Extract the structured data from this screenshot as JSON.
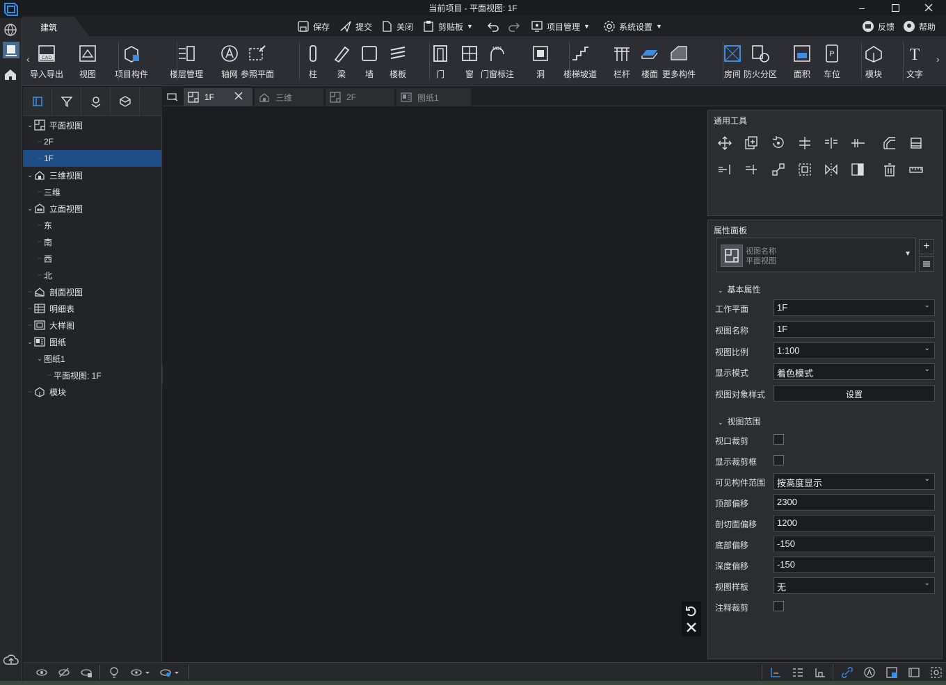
{
  "window": {
    "title": "当前项目 - 平面视图: 1F"
  },
  "ribbon_tab": "建筑",
  "quick_access": [
    {
      "label": "保存",
      "icon": "save-icon"
    },
    {
      "label": "提交",
      "icon": "submit-icon"
    },
    {
      "label": "关闭",
      "icon": "close-file-icon"
    },
    {
      "label": "剪贴板",
      "icon": "clipboard-icon"
    },
    {
      "label": "项目管理",
      "icon": "project-manage-icon"
    },
    {
      "label": "系统设置",
      "icon": "settings-icon"
    }
  ],
  "top_right": {
    "feedback": "反馈",
    "help": "帮助"
  },
  "ribbon": [
    {
      "label": "导入导出",
      "icon": "cad-import-export-icon"
    },
    {
      "label": "视图",
      "icon": "view-icon"
    },
    {
      "label": "项目构件",
      "icon": "project-component-icon"
    },
    {
      "label": "楼层管理",
      "icon": "floor-manage-icon"
    },
    {
      "label": "轴网",
      "icon": "axis-grid-icon"
    },
    {
      "label": "参照平面",
      "icon": "reference-plane-icon"
    },
    {
      "label": "柱",
      "icon": "column-icon"
    },
    {
      "label": "梁",
      "icon": "beam-icon"
    },
    {
      "label": "墙",
      "icon": "wall-icon"
    },
    {
      "label": "楼板",
      "icon": "slab-icon"
    },
    {
      "label": "门",
      "icon": "door-icon"
    },
    {
      "label": "窗",
      "icon": "window-icon"
    },
    {
      "label": "门窗标注",
      "icon": "door-window-tag-icon"
    },
    {
      "label": "洞",
      "icon": "opening-icon"
    },
    {
      "label": "楼梯坡道",
      "icon": "stair-ramp-icon"
    },
    {
      "label": "栏杆",
      "icon": "railing-icon"
    },
    {
      "label": "楼面",
      "icon": "floor-icon"
    },
    {
      "label": "更多构件",
      "icon": "more-components-icon"
    },
    {
      "label": "房间",
      "icon": "room-icon"
    },
    {
      "label": "防火分区",
      "icon": "fire-zone-icon"
    },
    {
      "label": "面积",
      "icon": "area-icon"
    },
    {
      "label": "车位",
      "icon": "parking-icon"
    },
    {
      "label": "模块",
      "icon": "module-icon"
    },
    {
      "label": "文字",
      "icon": "text-icon"
    }
  ],
  "tree": [
    {
      "label": "平面视图",
      "level": 0,
      "expand": "open",
      "icon": "plan-view-icon"
    },
    {
      "label": "2F",
      "level": 1
    },
    {
      "label": "1F",
      "level": 1,
      "selected": true
    },
    {
      "label": "三维视图",
      "level": 0,
      "expand": "open",
      "icon": "3d-view-icon"
    },
    {
      "label": "三维",
      "level": 1
    },
    {
      "label": "立面视图",
      "level": 0,
      "expand": "open",
      "icon": "elevation-view-icon"
    },
    {
      "label": "东",
      "level": 1
    },
    {
      "label": "南",
      "level": 1
    },
    {
      "label": "西",
      "level": 1
    },
    {
      "label": "北",
      "level": 1
    },
    {
      "label": "剖面视图",
      "level": 0,
      "icon": "section-view-icon"
    },
    {
      "label": "明细表",
      "level": 0,
      "icon": "schedule-icon"
    },
    {
      "label": "大样图",
      "level": 0,
      "icon": "detail-view-icon"
    },
    {
      "label": "图纸",
      "level": 0,
      "expand": "open",
      "icon": "sheet-icon"
    },
    {
      "label": "图纸1",
      "level": 1,
      "expand": "open"
    },
    {
      "label": "平面视图: 1F",
      "level": 2
    },
    {
      "label": "模块",
      "level": 0,
      "icon": "module-icon"
    }
  ],
  "doc_tabs": [
    {
      "label": "1F",
      "icon": "plan-view-icon",
      "active": true
    },
    {
      "label": "三维",
      "icon": "3d-view-icon"
    },
    {
      "label": "2F",
      "icon": "plan-view-icon"
    },
    {
      "label": "图纸1",
      "icon": "sheet-icon"
    }
  ],
  "tools_panel": {
    "title": "通用工具"
  },
  "props_panel": {
    "title": "属性面板",
    "view_name_label": "视图名称",
    "view_type": "平面视图",
    "section_basic": "基本属性",
    "work_plane_label": "工作平面",
    "work_plane": "1F",
    "name_label": "视图名称",
    "name_value": "1F",
    "scale_label": "视图比例",
    "scale": "1:100",
    "display_label": "显示模式",
    "display": "着色模式",
    "style_label": "视图对象样式",
    "style_btn": "设置",
    "section_range": "视图范围",
    "crop_label": "视口裁剪",
    "show_crop_label": "显示裁剪框",
    "visible_range_label": "可见构件范围",
    "visible_range": "按高度显示",
    "top_offset_label": "顶部偏移",
    "top_offset": "2300",
    "cut_offset_label": "剖切面偏移",
    "cut_offset": "1200",
    "bottom_offset_label": "底部偏移",
    "bottom_offset": "-150",
    "depth_offset_label": "深度偏移",
    "depth_offset": "-150",
    "template_label": "视图样板",
    "template": "无",
    "annotation_crop_label": "注释裁剪"
  },
  "colors": {
    "accent": "#1d4f86",
    "bg": "#1c1d20",
    "panel": "#2b2d31"
  }
}
